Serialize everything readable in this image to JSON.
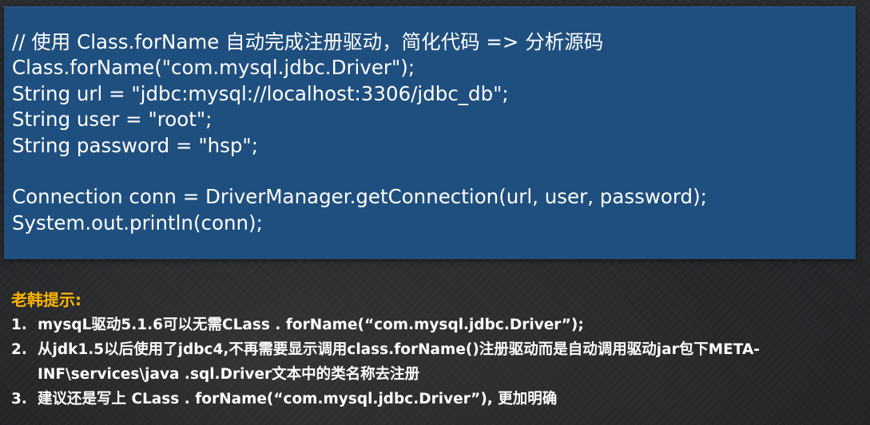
{
  "code": {
    "lines": [
      "// 使用 Class.forName 自动完成注册驱动，简化代码 => 分析源码",
      "Class.forName(\"com.mysql.jdbc.Driver\");",
      "String url = \"jdbc:mysql://localhost:3306/jdbc_db\";",
      "String user = \"root\";",
      "String password = \"hsp\";",
      "",
      "Connection conn = DriverManager.getConnection(url, user, password);",
      "System.out.println(conn);"
    ]
  },
  "tips": {
    "title": "老韩提示:",
    "items": [
      {
        "number": "1.",
        "text": "mysqL驱动5.1.6可以无需CLass . forName(“com.mysql.jdbc.Driver”);"
      },
      {
        "number": "2.",
        "text": "从jdk1.5以后使用了jdbc4,不再需要显示调用class.forName()注册驱动而是自动调用驱动jar包下META-INF\\services\\java .sql.Driver文本中的类名称去注册"
      },
      {
        "number": "3.",
        "text": "建议还是写上 CLass . forName(“com.mysql.jdbc.Driver”), 更加明确"
      }
    ]
  },
  "colors": {
    "code_background": "#1f4f7e",
    "title_accent": "#ffb400",
    "text": "#ffffff",
    "page_background": "#222427"
  }
}
